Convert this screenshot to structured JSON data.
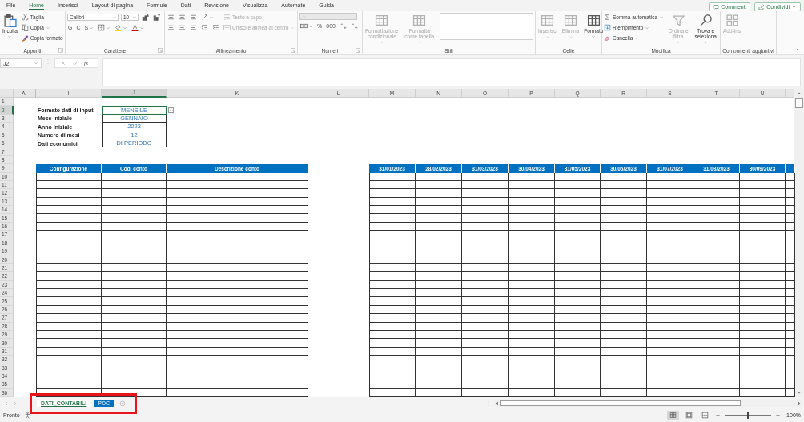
{
  "menu": {
    "tabs": [
      {
        "label": "File",
        "selected": false
      },
      {
        "label": "Home",
        "selected": true
      },
      {
        "label": "Inserisci",
        "selected": false
      },
      {
        "label": "Layout di pagina",
        "selected": false
      },
      {
        "label": "Formule",
        "selected": false
      },
      {
        "label": "Dati",
        "selected": false
      },
      {
        "label": "Revisione",
        "selected": false
      },
      {
        "label": "Visualizza",
        "selected": false
      },
      {
        "label": "Automate",
        "selected": false
      },
      {
        "label": "Guida",
        "selected": false
      }
    ]
  },
  "actions": [
    {
      "label": "Commenti",
      "menu": false
    },
    {
      "label": "Condividi",
      "menu": true
    }
  ],
  "ribbon": {
    "groups": [
      {
        "label": "Appunti",
        "launcher": true,
        "columns": [
          [
            [
              {
                "kind": "big",
                "label": "Incolla",
                "menu": true,
                "disabled": false
              }
            ]
          ],
          [
            [
              {
                "kind": "tool",
                "label": "Taglia",
                "menu": false,
                "disabled": false
              }
            ],
            [
              {
                "kind": "tool",
                "label": "Copia",
                "menu": true,
                "disabled": false
              }
            ],
            [
              {
                "kind": "tool",
                "label": "Copia formato",
                "menu": false,
                "disabled": false
              }
            ]
          ]
        ]
      },
      {
        "label": "Carattere",
        "launcher": true,
        "columns": [
          [
            [
              {
                "kind": "combo",
                "label": "Calibri",
                "menu": true,
                "disabled": false
              },
              {
                "kind": "combo",
                "label": "10",
                "menu": true,
                "disabled": false
              },
              {
                "kind": "iconbtn",
                "menu": false,
                "disabled": false
              },
              {
                "kind": "iconbtn",
                "menu": false,
                "disabled": false
              }
            ],
            [
              {
                "kind": "glyph",
                "label": "G",
                "menu": false,
                "disabled": false
              },
              {
                "kind": "glyph",
                "label": "C",
                "menu": false,
                "disabled": false
              },
              {
                "kind": "glyph",
                "label": "S",
                "menu": true,
                "disabled": false
              },
              {
                "kind": "iconbtn",
                "menu": true,
                "disabled": false
              },
              {
                "kind": "iconbtn",
                "menu": true,
                "disabled": false
              },
              {
                "kind": "iconbtn",
                "menu": true,
                "disabled": false
              }
            ]
          ]
        ]
      },
      {
        "label": "Allineamento",
        "launcher": true,
        "columns": [
          [
            [
              {
                "kind": "iconbtn",
                "menu": false,
                "disabled": false
              },
              {
                "kind": "iconbtn",
                "menu": false,
                "disabled": false
              },
              {
                "kind": "iconbtn",
                "menu": false,
                "disabled": false
              },
              {
                "kind": "iconbtn",
                "menu": true,
                "disabled": false
              }
            ],
            [
              {
                "kind": "iconbtn",
                "menu": false,
                "disabled": false
              },
              {
                "kind": "iconbtn",
                "menu": false,
                "disabled": false
              },
              {
                "kind": "iconbtn",
                "menu": false,
                "disabled": false
              },
              {
                "kind": "iconbtn",
                "menu": false,
                "disabled": false
              },
              {
                "kind": "iconbtn",
                "menu": false,
                "disabled": false
              }
            ]
          ],
          [
            [
              {
                "kind": "tool",
                "label": "Testo a capo",
                "menu": false,
                "disabled": true
              }
            ],
            [
              {
                "kind": "tool",
                "label": "Unisci e allinea al centro",
                "menu": true,
                "disabled": true
              }
            ]
          ]
        ]
      },
      {
        "label": "Numeri",
        "launcher": true,
        "columns": [
          [
            [
              {
                "kind": "combo",
                "menu": true,
                "disabled": true
              }
            ],
            [
              {
                "kind": "iconbtn",
                "menu": true,
                "disabled": false
              },
              {
                "kind": "glyph",
                "label": "%",
                "menu": false,
                "disabled": false
              },
              {
                "kind": "glyph",
                "label": "000",
                "menu": false,
                "disabled": false
              },
              {
                "kind": "iconbtn",
                "menu": false,
                "disabled": false
              },
              {
                "kind": "iconbtn",
                "menu": false,
                "disabled": false
              }
            ]
          ]
        ]
      },
      {
        "label": "Stili",
        "launcher": false,
        "columns": [
          [
            [
              {
                "kind": "big",
                "label": "Formattazione condizionale",
                "menu": true,
                "disabled": true
              }
            ]
          ],
          [
            [
              {
                "kind": "big",
                "label": "Formatta come tabella",
                "menu": true,
                "disabled": true
              }
            ]
          ],
          [
            [
              {
                "kind": "gallery"
              }
            ]
          ]
        ]
      },
      {
        "label": "Celle",
        "launcher": false,
        "columns": [
          [
            [
              {
                "kind": "big",
                "label": "Inserisci",
                "menu": true,
                "disabled": true
              }
            ]
          ],
          [
            [
              {
                "kind": "big",
                "label": "Elimina",
                "menu": true,
                "disabled": true
              }
            ]
          ],
          [
            [
              {
                "kind": "big",
                "label": "Formato",
                "menu": true,
                "disabled": false
              }
            ]
          ]
        ]
      },
      {
        "label": "Modifica",
        "launcher": false,
        "columns": [
          [
            [
              {
                "kind": "tool",
                "label": "Somma automatica",
                "menu": true,
                "disabled": false
              }
            ],
            [
              {
                "kind": "tool",
                "label": "Riempimento",
                "menu": true,
                "disabled": false
              }
            ],
            [
              {
                "kind": "tool",
                "label": "Cancella",
                "menu": true,
                "disabled": false
              }
            ]
          ],
          [
            [
              {
                "kind": "big",
                "label": "Ordina e filtra",
                "menu": true,
                "disabled": true
              }
            ]
          ],
          [
            [
              {
                "kind": "big",
                "label": "Trova e seleziona",
                "menu": true,
                "disabled": false
              }
            ]
          ]
        ]
      },
      {
        "label": "Componenti aggiuntivi",
        "launcher": false,
        "columns": [
          [
            [
              {
                "kind": "big",
                "label": "Add-ins",
                "menu": false,
                "disabled": true
              }
            ]
          ]
        ]
      }
    ]
  },
  "formula_bar": {
    "name_box": "J2",
    "function_button": "fx"
  },
  "sheet": {
    "columns": [
      {
        "letter": "A",
        "selected": false
      },
      {
        "letter": "I",
        "selected": false
      },
      {
        "letter": "J",
        "selected": true
      },
      {
        "letter": "K",
        "selected": false
      },
      {
        "letter": "L",
        "selected": false
      },
      {
        "letter": "M",
        "selected": false
      },
      {
        "letter": "N",
        "selected": false
      },
      {
        "letter": "O",
        "selected": false
      },
      {
        "letter": "P",
        "selected": false
      },
      {
        "letter": "Q",
        "selected": false
      },
      {
        "letter": "R",
        "selected": false
      },
      {
        "letter": "S",
        "selected": false
      },
      {
        "letter": "T",
        "selected": false
      },
      {
        "letter": "U",
        "selected": false
      }
    ],
    "left_headers": [
      "Configurazione",
      "Cod. conto",
      "Descrizione conto"
    ],
    "right_headers": [
      "31/01/2023",
      "28/02/2023",
      "31/03/2023",
      "30/04/2023",
      "31/05/2023",
      "30/06/2023",
      "31/07/2023",
      "31/08/2023",
      "30/09/2023"
    ],
    "rows": [
      {
        "number": "1",
        "kind": "blank",
        "selected": false
      },
      {
        "number": "2",
        "kind": "param",
        "label": "Formato dati di input",
        "value": "MENSILE",
        "selected": true
      },
      {
        "number": "3",
        "kind": "param",
        "label": "Mese iniziale",
        "value": "GENNAIO",
        "selected": false
      },
      {
        "number": "4",
        "kind": "param",
        "label": "Anno iniziale",
        "value": "2023",
        "selected": false
      },
      {
        "number": "5",
        "kind": "param",
        "label": "Numero di mesi",
        "value": "12",
        "selected": false
      },
      {
        "number": "6",
        "kind": "param",
        "label": "Dati economici",
        "value": "DI PERIODO",
        "selected": false
      },
      {
        "number": "7",
        "kind": "blank",
        "selected": false
      },
      {
        "number": "8",
        "kind": "blank",
        "selected": false
      },
      {
        "number": "9",
        "kind": "header",
        "selected": false
      },
      {
        "number": "10",
        "kind": "body",
        "selected": false
      },
      {
        "number": "11",
        "kind": "body",
        "selected": false
      },
      {
        "number": "12",
        "kind": "body",
        "selected": false
      },
      {
        "number": "13",
        "kind": "body",
        "selected": false
      },
      {
        "number": "14",
        "kind": "body",
        "selected": false
      },
      {
        "number": "15",
        "kind": "body",
        "selected": false
      },
      {
        "number": "16",
        "kind": "body",
        "selected": false
      },
      {
        "number": "17",
        "kind": "body",
        "selected": false
      },
      {
        "number": "18",
        "kind": "body",
        "selected": false
      },
      {
        "number": "19",
        "kind": "body",
        "selected": false
      },
      {
        "number": "20",
        "kind": "body",
        "selected": false
      },
      {
        "number": "21",
        "kind": "body",
        "selected": false
      },
      {
        "number": "22",
        "kind": "body",
        "selected": false
      },
      {
        "number": "23",
        "kind": "body",
        "selected": false
      },
      {
        "number": "24",
        "kind": "body",
        "selected": false
      },
      {
        "number": "25",
        "kind": "body",
        "selected": false
      },
      {
        "number": "26",
        "kind": "body",
        "selected": false
      },
      {
        "number": "27",
        "kind": "body",
        "selected": false
      },
      {
        "number": "28",
        "kind": "body",
        "selected": false
      },
      {
        "number": "29",
        "kind": "body",
        "selected": false
      },
      {
        "number": "30",
        "kind": "body",
        "selected": false
      },
      {
        "number": "31",
        "kind": "body",
        "selected": false
      },
      {
        "number": "32",
        "kind": "body",
        "selected": false
      },
      {
        "number": "33",
        "kind": "body",
        "selected": false
      },
      {
        "number": "34",
        "kind": "body",
        "selected": false
      },
      {
        "number": "35",
        "kind": "body",
        "selected": false
      },
      {
        "number": "36",
        "kind": "body",
        "selected": false
      }
    ]
  },
  "sheet_tabs": [
    {
      "label": "DATI_CONTABILI",
      "selected": true
    },
    {
      "label": "PDC",
      "selected": false,
      "color": "#0070c0"
    }
  ],
  "status_bar": {
    "status": "Pronto",
    "views": [
      {
        "selected": true
      },
      {
        "selected": false
      },
      {
        "selected": false
      }
    ],
    "zoom": {
      "level": 0.5,
      "reading": "100%"
    }
  }
}
